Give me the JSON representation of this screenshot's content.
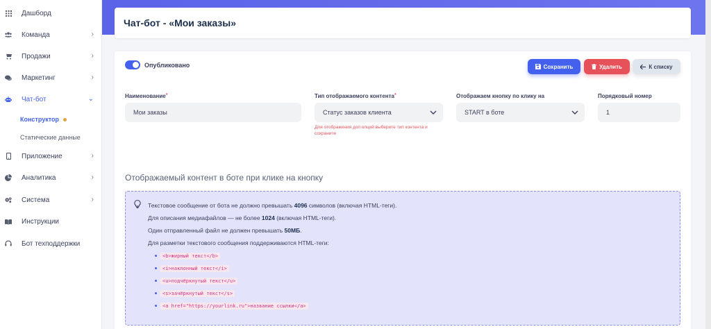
{
  "sidebar": {
    "items": [
      {
        "label": "Дашборд",
        "icon": "grid-icon",
        "chevron": false
      },
      {
        "label": "Команда",
        "icon": "users-icon",
        "chevron": true
      },
      {
        "label": "Продажи",
        "icon": "cart-icon",
        "chevron": true
      },
      {
        "label": "Маркетинг",
        "icon": "chat-icon",
        "chevron": true
      },
      {
        "label": "Чат-бот",
        "icon": "robot-icon",
        "chevron": true,
        "active": true
      },
      {
        "label": "Приложение",
        "icon": "phone-icon",
        "chevron": true
      },
      {
        "label": "Аналитика",
        "icon": "pie-chart-icon",
        "chevron": true
      },
      {
        "label": "Система",
        "icon": "gears-icon",
        "chevron": true
      },
      {
        "label": "Инструкции",
        "icon": "book-icon",
        "chevron": false
      },
      {
        "label": "Бот техподдержки",
        "icon": "headset-icon",
        "chevron": false
      }
    ],
    "subitems": [
      {
        "label": "Конструктор",
        "active": true
      },
      {
        "label": "Статические данные",
        "active": false
      }
    ]
  },
  "header": {
    "title": "Чат-бот - «Мои заказы»"
  },
  "toolbar": {
    "published_label": "Опубликовано",
    "save_label": "Сохранить",
    "delete_label": "Удалить",
    "back_label": "К списку"
  },
  "form": {
    "name_label": "Наименование",
    "name_value": "Мои заказы",
    "content_type_label": "Тип отображаемого контента",
    "content_type_value": "Статус заказов клиента",
    "content_type_hint": "Для отображения доп опций выберите тип контента и сохраните",
    "button_label": "Отображаем кнопку по клику на",
    "button_value": "START в боте",
    "order_label": "Порядковый номер",
    "order_value": "1"
  },
  "content": {
    "section_title": "Отображаемый контент в боте при клике на кнопку",
    "info": {
      "line1_pre": "Текстовое сообщение от бота не должно превышать ",
      "line1_bold": "4096",
      "line1_post": " символов (включая HTML-теги).",
      "line2_pre": "Для описания медиафайлов — не более ",
      "line2_bold": "1024",
      "line2_post": " (включая HTML-теги).",
      "line3_pre": "Один отправленный файл не должен превышать ",
      "line3_bold": "50МБ",
      "line3_post": ".",
      "line4": "Для разметки текстового сообщения поддерживаются HTML-теги:",
      "codes": [
        "<b>жирный текст</b>",
        "<i>наклонный текст</i>",
        "<u>подчёркнутый текст</u>",
        "<s>зачёркнутый текст</s>",
        "<a href=\"https://yourlink.ru\">название ссылки</a>"
      ]
    }
  },
  "colors": {
    "primary": "#4361ee",
    "danger": "#e7515a",
    "warning_dot": "#e2a03f",
    "info_bg": "#e3e4fc"
  }
}
